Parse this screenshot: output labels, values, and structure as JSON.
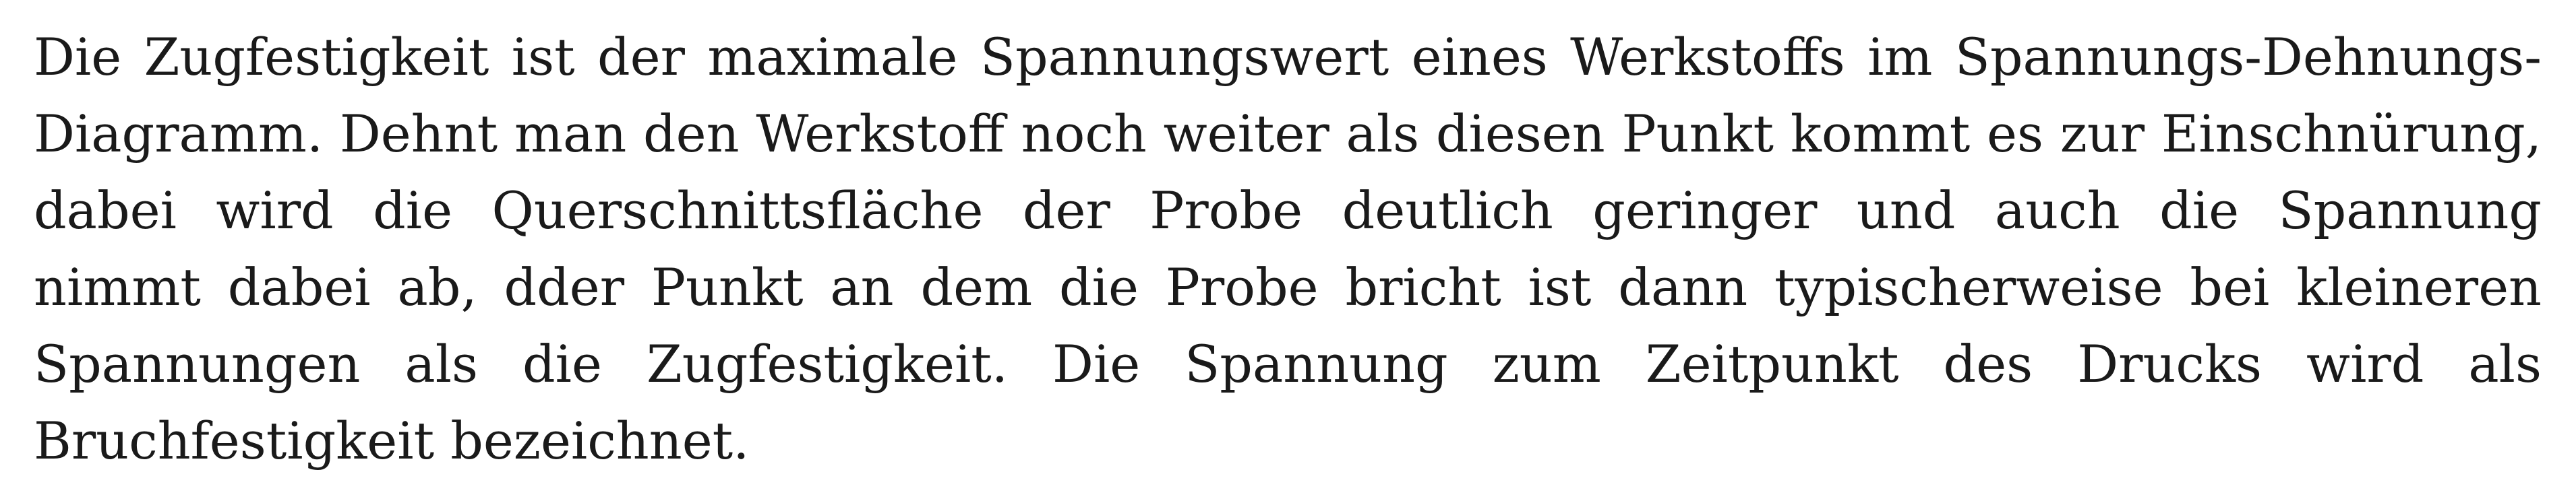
{
  "document": {
    "lines": [
      "Die Zugfestigkeit ist der maximale Spannungswert eines Werkstoffs im Spannungs-Dehnungs-",
      "Diagramm. Dehnt man den Werkstoff noch weiter als diesen Punkt kommt es zur Einschnürung,",
      "dabei wird die Querschnittsfläche der Probe deutlich geringer und auch die Spannung",
      "nimmt dabei ab, dder Punkt an dem die Probe bricht ist dann typischerweise bei kleineren",
      "Spannungen als die Zugfestigkeit. Die Spannung zum Zeitpunkt des Drucks wird als",
      "Bruchfestigkeit bezeichnet."
    ]
  }
}
